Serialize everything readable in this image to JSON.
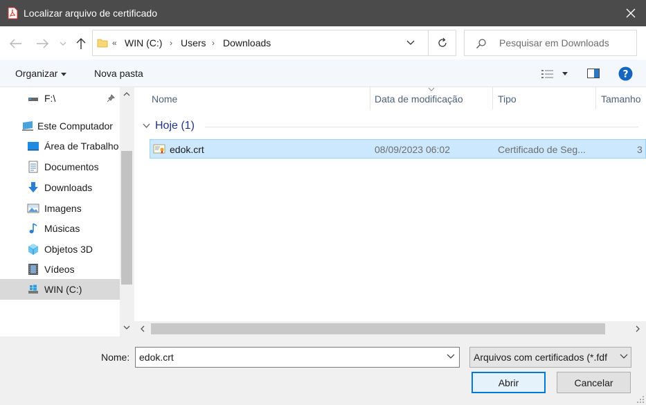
{
  "window": {
    "title": "Localizar arquivo de certificado",
    "accent": "#0078d7"
  },
  "nav": {
    "breadcrumb": [
      "WIN (C:)",
      "Users",
      "Downloads"
    ],
    "search_placeholder": "Pesquisar em Downloads"
  },
  "toolbar": {
    "organize_label": "Organizar",
    "new_folder_label": "Nova pasta"
  },
  "sidebar": {
    "items": [
      {
        "label": "F:\\",
        "icon": "drive-icon"
      },
      {
        "label": "Este Computador",
        "icon": "computer-icon"
      },
      {
        "label": "Área de Trabalho",
        "icon": "desktop-icon"
      },
      {
        "label": "Documentos",
        "icon": "documents-icon"
      },
      {
        "label": "Downloads",
        "icon": "downloads-icon"
      },
      {
        "label": "Imagens",
        "icon": "pictures-icon"
      },
      {
        "label": "Músicas",
        "icon": "music-icon"
      },
      {
        "label": "Objetos 3D",
        "icon": "objects3d-icon"
      },
      {
        "label": "Vídeos",
        "icon": "videos-icon"
      },
      {
        "label": "WIN (C:)",
        "icon": "windows-drive-icon",
        "selected": true
      }
    ]
  },
  "filelist": {
    "columns": [
      "Nome",
      "Data de modificação",
      "Tipo",
      "Tamanho"
    ],
    "group_label": "Hoje (1)",
    "rows": [
      {
        "name": "edok.crt",
        "modified": "08/09/2023 06:02",
        "type": "Certificado de Seg...",
        "size": "3"
      }
    ]
  },
  "footer": {
    "filename_label": "Nome:",
    "filename_value": "edok.crt",
    "filetype_value": "Arquivos com certificados (*.fdf",
    "open_label": "Abrir",
    "cancel_label": "Cancelar"
  }
}
